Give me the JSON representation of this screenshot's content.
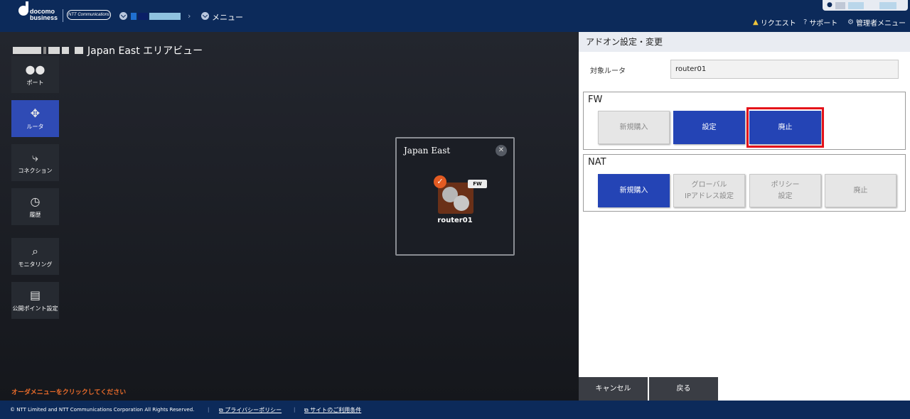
{
  "header": {
    "logo_line1": "docomo",
    "logo_line2": "business",
    "ntt_logo": "NTT Communications",
    "menu_label": "メニュー",
    "request_label": "リクエスト",
    "support_label": "サポート",
    "admin_menu_label": "管理者メニュー"
  },
  "canvas": {
    "area_title": "Japan East エリアビュー",
    "order_hint": "オーダメニューをクリックしてください",
    "sidebar": [
      {
        "label": "ポート",
        "icon": "port-icon",
        "active": false
      },
      {
        "label": "ルータ",
        "icon": "router-icon",
        "active": true
      },
      {
        "label": "コネクション",
        "icon": "connection-icon",
        "active": false
      },
      {
        "label": "履歴",
        "icon": "history-icon",
        "active": false
      },
      {
        "label": "モニタリング",
        "icon": "monitoring-icon",
        "active": false
      },
      {
        "label": "公開ポイント設定",
        "icon": "public-point-icon",
        "active": false
      }
    ],
    "region_box": {
      "title": "Japan East",
      "router_name": "router01",
      "router_badge": "FW"
    }
  },
  "panel": {
    "title": "アドオン設定・変更",
    "target_label": "対象ルータ",
    "target_value": "router01",
    "fw": {
      "title": "FW",
      "buttons": [
        "新規購入",
        "設定",
        "廃止"
      ]
    },
    "nat": {
      "title": "NAT",
      "buttons": [
        "新規購入",
        "グローバル IPアドレス設定",
        "ポリシー 設定",
        "廃止"
      ],
      "button_lines": [
        [
          "新規購入"
        ],
        [
          "グローバル",
          "IPアドレス設定"
        ],
        [
          "ポリシー",
          "設定"
        ],
        [
          "廃止"
        ]
      ]
    },
    "cancel_label": "キャンセル",
    "back_label": "戻る"
  },
  "footer": {
    "copyright": "© NTT Limited and NTT Communications Corporation All Rights Reserved.",
    "privacy_label": "プライバシーポリシー",
    "terms_label": "サイトのご利用条件"
  },
  "colors": {
    "header_bg": "#0c2a5a",
    "primary_button": "#2444b5",
    "highlight": "#e4121a",
    "hint_orange": "#e96b2a"
  }
}
